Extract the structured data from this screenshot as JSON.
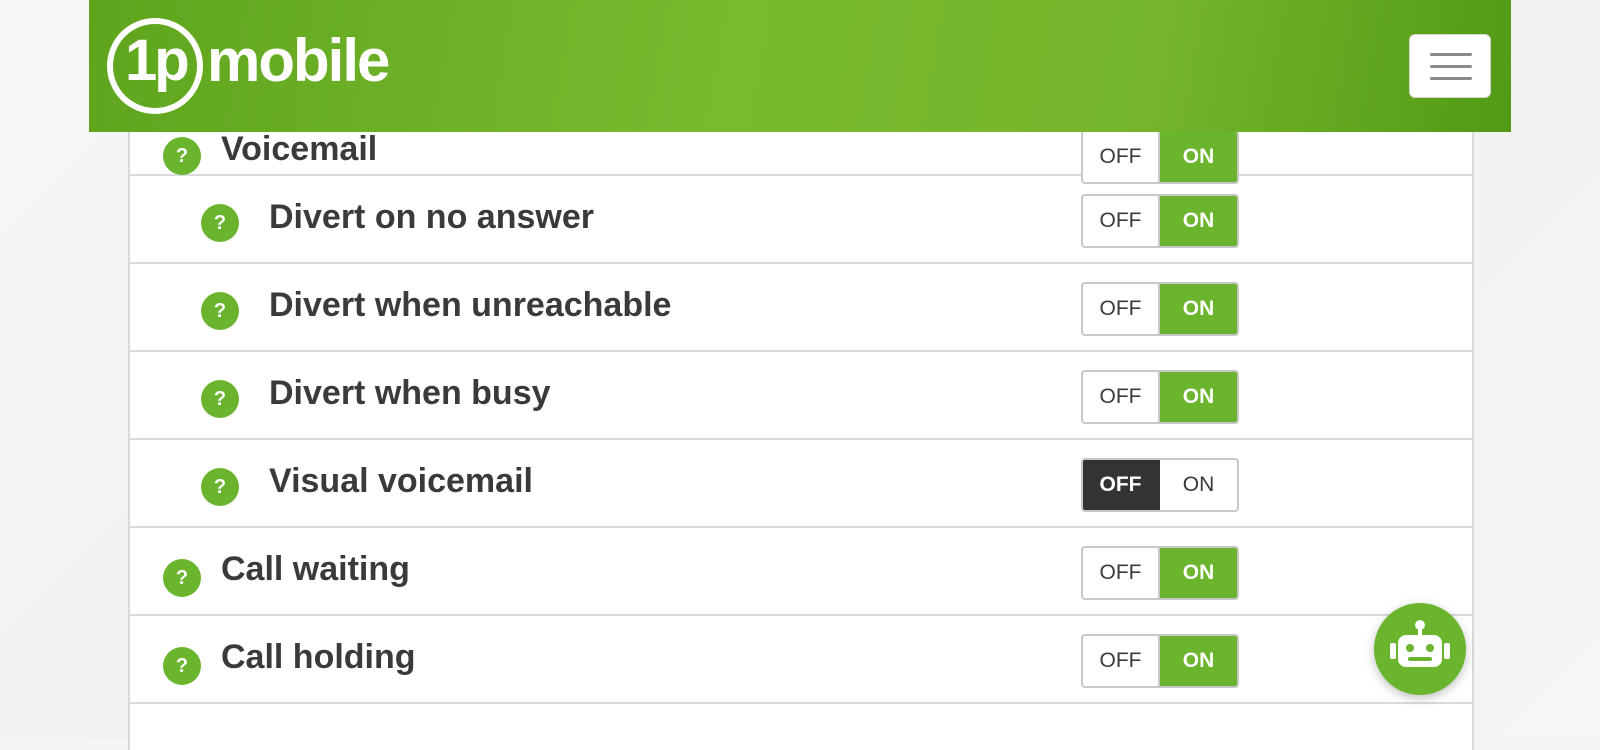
{
  "header": {
    "logo_text_1p": "1p",
    "logo_text_mobile": "mobile",
    "menu_icon": "hamburger-icon"
  },
  "settings": [
    {
      "label": "Voicemail",
      "level": 0,
      "state": "on"
    },
    {
      "label": "Divert on no answer",
      "level": 1,
      "state": "on"
    },
    {
      "label": "Divert when unreachable",
      "level": 1,
      "state": "on"
    },
    {
      "label": "Divert when busy",
      "level": 1,
      "state": "on"
    },
    {
      "label": "Visual voicemail",
      "level": 1,
      "state": "off"
    },
    {
      "label": "Call waiting",
      "level": 0,
      "state": "on"
    },
    {
      "label": "Call holding",
      "level": 0,
      "state": "on"
    }
  ],
  "toggle_labels": {
    "off": "OFF",
    "on": "ON"
  },
  "help_icon_text": "?",
  "chat_icon": "robot-icon",
  "colors": {
    "brand_green": "#6ab52d",
    "dark_off": "#333333",
    "text": "#3a3a3a"
  }
}
